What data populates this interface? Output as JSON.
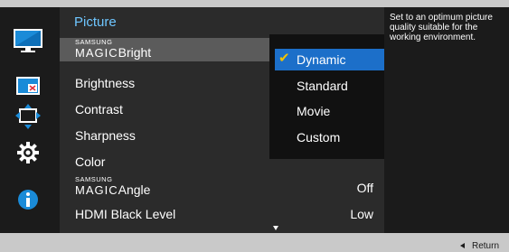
{
  "panel": {
    "title": "Picture"
  },
  "menu": {
    "magic_bright": {
      "brand_top": "SAMSUNG",
      "brand_bottom": "MAGIC",
      "suffix": "Bright"
    },
    "brightness": {
      "label": "Brightness"
    },
    "contrast": {
      "label": "Contrast"
    },
    "sharpness": {
      "label": "Sharpness"
    },
    "color": {
      "label": "Color"
    },
    "magic_angle": {
      "brand_top": "SAMSUNG",
      "brand_bottom": "MAGIC",
      "suffix": "Angle",
      "value": "Off"
    },
    "hdmi_black_level": {
      "label": "HDMI Black Level",
      "value": "Low"
    }
  },
  "dropdown": {
    "options": [
      "Dynamic",
      "Standard",
      "Movie",
      "Custom"
    ],
    "selected": "Dynamic"
  },
  "description": "Set to an optimum picture quality suitable for the working environment.",
  "footer": {
    "return_label": "Return"
  },
  "left_icons": [
    "picture-icon",
    "screen-adjust-icon",
    "position-icon",
    "settings-gear-icon",
    "info-icon"
  ],
  "colors": {
    "accent_title": "#6ec6ff",
    "selection": "#1c6fc9",
    "check": "#f2c200"
  }
}
